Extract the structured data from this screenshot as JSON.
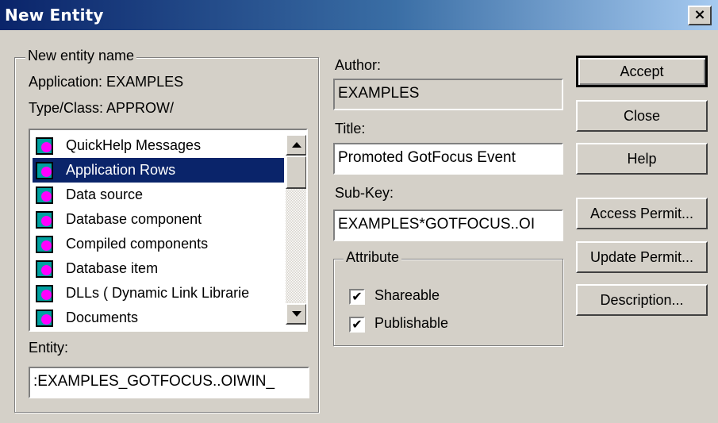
{
  "window": {
    "title": "New Entity",
    "close_glyph": "×"
  },
  "new_entity": {
    "legend": "New entity name",
    "application": "Application:  EXAMPLES",
    "type_class": "Type/Class: APPROW/",
    "list_items": [
      {
        "label": "QuickHelp Messages",
        "icon": "entity-type-icon",
        "selected": false
      },
      {
        "label": "Application Rows",
        "icon": "entity-type-icon",
        "selected": true
      },
      {
        "label": "Data source",
        "icon": "entity-type-icon",
        "selected": false
      },
      {
        "label": "Database component",
        "icon": "entity-type-icon",
        "selected": false
      },
      {
        "label": "Compiled components",
        "icon": "entity-type-icon",
        "selected": false
      },
      {
        "label": "Database item",
        "icon": "entity-type-icon",
        "selected": false
      },
      {
        "label": "DLLs ( Dynamic Link Librarie",
        "icon": "entity-type-icon",
        "selected": false
      },
      {
        "label": "Documents",
        "icon": "entity-type-icon",
        "selected": false
      }
    ],
    "entity_label": "Entity:",
    "entity_value": ":EXAMPLES_GOTFOCUS..OIWIN_"
  },
  "details": {
    "author_label": "Author:",
    "author_value": "EXAMPLES",
    "title_label": "Title:",
    "title_value": "Promoted GotFocus Event",
    "subkey_label": "Sub-Key:",
    "subkey_value": "EXAMPLES*GOTFOCUS..OI"
  },
  "attribute": {
    "legend": "Attribute",
    "shareable_label": "Shareable",
    "shareable_checked": true,
    "publishable_label": "Publishable",
    "publishable_checked": true,
    "check_glyph": "✔"
  },
  "buttons": {
    "accept": "Accept",
    "close": "Close",
    "help": "Help",
    "access_permit": "Access Permit...",
    "update_permit": "Update Permit...",
    "description": "Description..."
  }
}
